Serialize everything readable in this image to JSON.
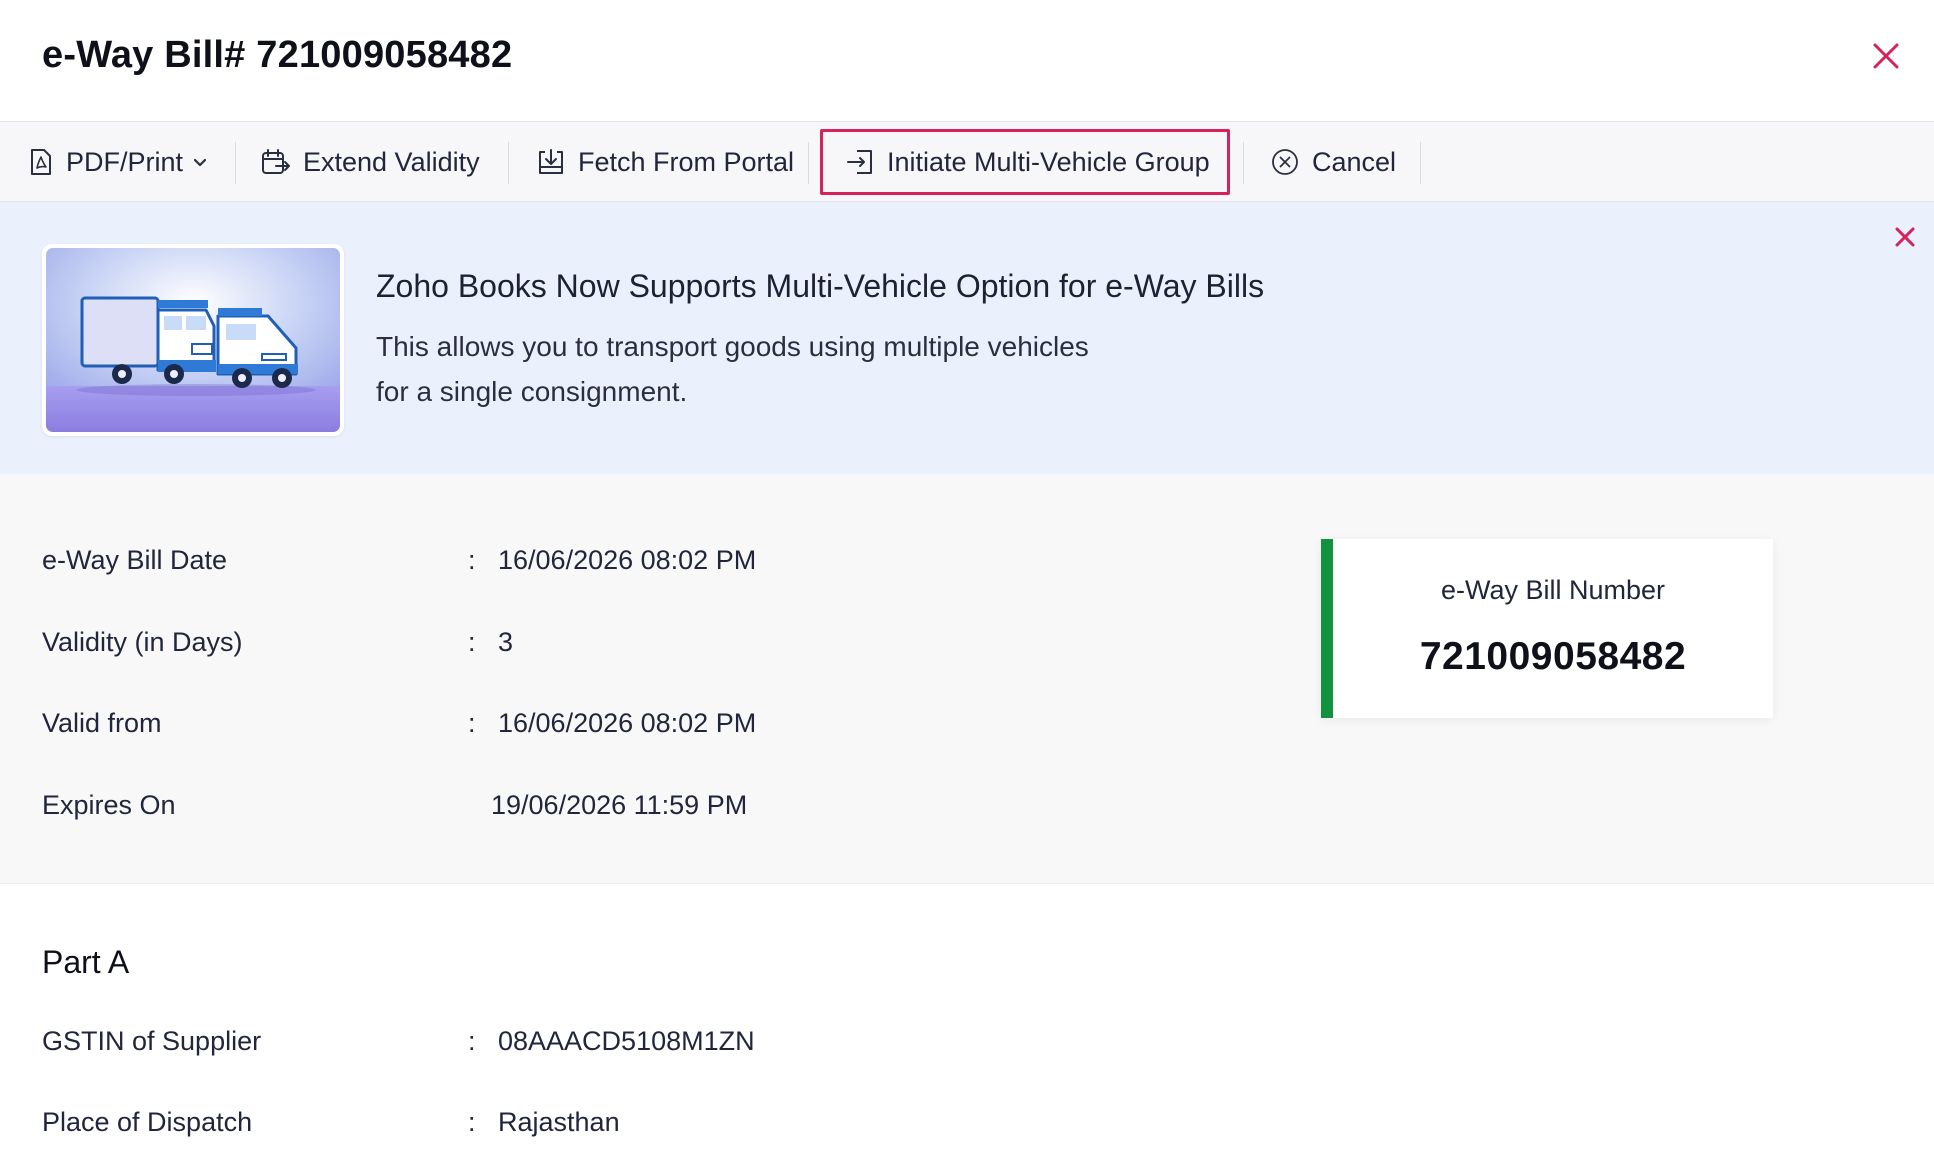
{
  "header": {
    "title": "e-Way Bill# 721009058482"
  },
  "toolbar": {
    "pdf_print": "PDF/Print",
    "extend_validity": "Extend Validity",
    "fetch_from_portal": "Fetch From Portal",
    "initiate_multi_vehicle": "Initiate Multi-Vehicle Group",
    "cancel": "Cancel"
  },
  "banner": {
    "title": "Zoho Books Now Supports Multi-Vehicle Option for e-Way Bills",
    "desc_line1": "This allows you to transport goods using multiple vehicles",
    "desc_line2": "for a single consignment."
  },
  "details": {
    "eway_bill_date_label": "e-Way Bill Date",
    "eway_bill_date_value": "16/06/2026 08:02 PM",
    "validity_label": "Validity (in Days)",
    "validity_value": "3",
    "valid_from_label": "Valid from",
    "valid_from_value": "16/06/2026 08:02 PM",
    "expires_on_label": "Expires On",
    "expires_on_value": "19/06/2026 11:59 PM",
    "separator": ":"
  },
  "ewb_card": {
    "label": "e-Way Bill Number",
    "number": "721009058482"
  },
  "part_a": {
    "title": "Part A",
    "gstin_label": "GSTIN of Supplier",
    "gstin_value": "08AAACD5108M1ZN",
    "dispatch_label": "Place of Dispatch",
    "dispatch_value": "Rajasthan"
  },
  "colors": {
    "accent_red": "#d6215b",
    "status_green": "#12913f",
    "banner_bg": "#ebf1fc"
  }
}
